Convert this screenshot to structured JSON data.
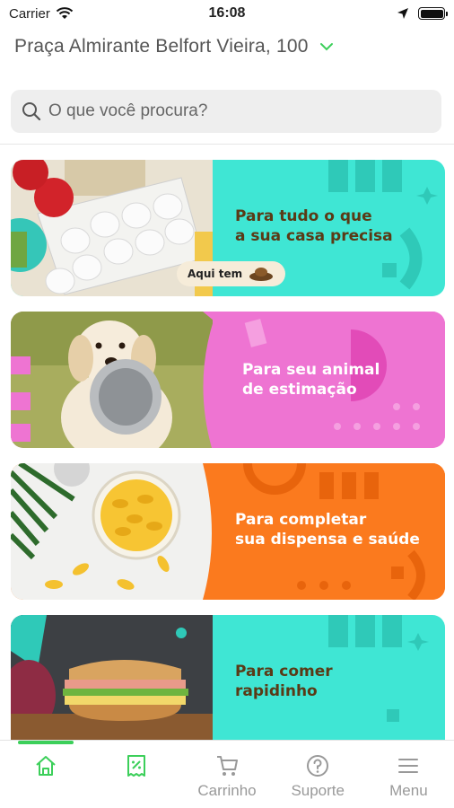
{
  "status_bar": {
    "carrier": "Carrier",
    "time": "16:08"
  },
  "address": {
    "text": "Praça Almirante Belfort Vieira, 100"
  },
  "search": {
    "placeholder": "O que você procura?"
  },
  "categories": [
    {
      "title": "Para tudo o que\na sua casa precisa",
      "badge": "Aqui tem",
      "color": "#3fe6d4",
      "image": "eggs-groceries"
    },
    {
      "title": "Para seu animal\nde estimação",
      "color": "#ee74d2",
      "image": "dog-with-bowl"
    },
    {
      "title": "Para completar\nsua dispensa e saúde",
      "color": "#fb7a1e",
      "image": "capsules-jar"
    },
    {
      "title": "Para comer\nrapidinho",
      "color": "#3fe6d4",
      "image": "sandwich"
    }
  ],
  "tab_bar": {
    "items": [
      {
        "label": "",
        "icon": "home-icon",
        "active": true
      },
      {
        "label": "",
        "icon": "coupon-icon",
        "active": false
      },
      {
        "label": "Carrinho",
        "icon": "cart-icon",
        "active": false
      },
      {
        "label": "Suporte",
        "icon": "help-icon",
        "active": false
      },
      {
        "label": "Menu",
        "icon": "menu-icon",
        "active": false
      }
    ]
  },
  "colors": {
    "accent": "#3ccf5a",
    "teal": "#3fe6d4",
    "pink": "#ee74d2",
    "orange": "#fb7a1e"
  }
}
